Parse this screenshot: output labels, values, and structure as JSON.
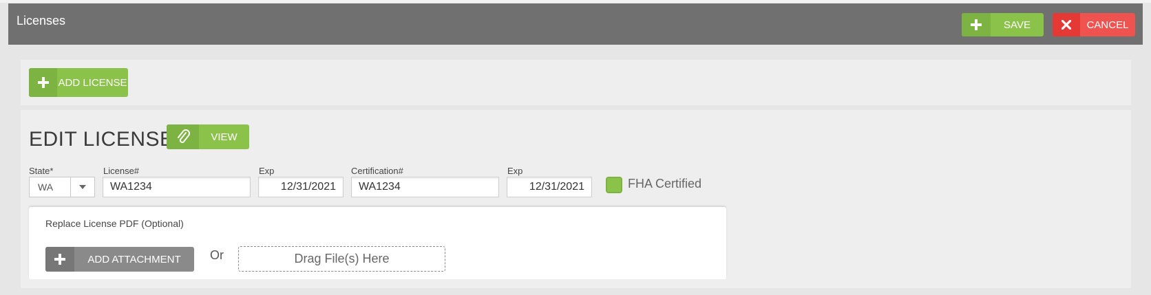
{
  "header": {
    "title": "Licenses",
    "save_label": "SAVE",
    "cancel_label": "CANCEL"
  },
  "toolbar": {
    "add_license_label": "ADD LICENSE"
  },
  "edit": {
    "title": "EDIT LICENSE",
    "view_label": "VIEW",
    "fields": {
      "state_label": "State*",
      "state_value": "WA",
      "license_label": "License#",
      "license_value": "WA1234",
      "exp1_label": "Exp",
      "exp1_value": "12/31/2021",
      "cert_label": "Certification#",
      "cert_value": "WA1234",
      "exp2_label": "Exp",
      "exp2_value": "12/31/2021"
    },
    "fha_label": "FHA Certified",
    "fha_checked": true
  },
  "attachment": {
    "label": "Replace License PDF (Optional)",
    "add_label": "ADD ATTACHMENT",
    "or_text": "Or",
    "dropzone_text": "Drag File(s) Here"
  },
  "colors": {
    "green": "#8bc34a",
    "green_dark": "#7cb342",
    "red": "#ef5350",
    "header_gray": "#707070",
    "button_gray": "#8a8a8a"
  }
}
